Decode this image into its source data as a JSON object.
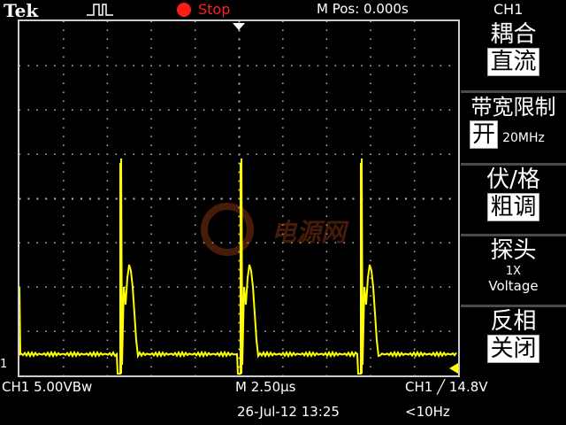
{
  "header": {
    "brand": "Tek",
    "run_status": "Stop",
    "m_pos": "M Pos: 0.000s",
    "channel": "CH1"
  },
  "menu": {
    "coupling_title": "耦合",
    "coupling_value": "直流",
    "bw_title": "带宽限制",
    "bw_value": "开",
    "bw_freq": "20MHz",
    "volts_title": "伏/格",
    "volts_value": "粗调",
    "probe_title": "探头",
    "probe_atten": "1X",
    "probe_type": "Voltage",
    "invert_title": "反相",
    "invert_value": "关闭"
  },
  "status": {
    "ch1_scale": "CH1  5.00VBw",
    "timebase": "M 2.50µs",
    "trigger": "CH1 ╱ 14.8V",
    "datetime": "26-Jul-12 13:25",
    "frequency": "<10Hz"
  },
  "markers": {
    "channel_marker": "1"
  },
  "watermark": {
    "text": "电源网"
  },
  "colors": {
    "trace": "#ffff00",
    "background": "#000000",
    "stop": "#ff2020",
    "grid": "#bbbbbb"
  }
}
